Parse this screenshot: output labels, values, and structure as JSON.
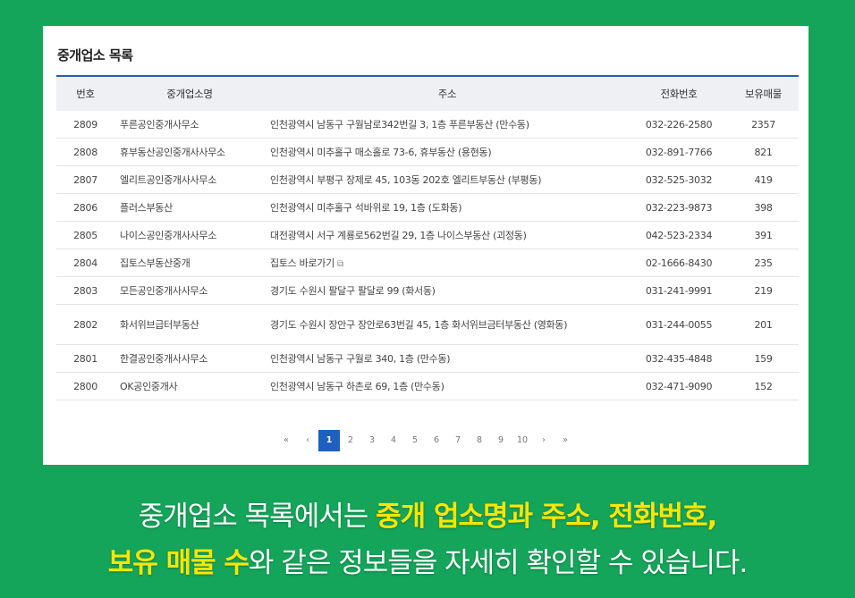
{
  "panel": {
    "title": "중개업소 목록",
    "columns": [
      "번호",
      "중개업소명",
      "주소",
      "전화번호",
      "보유매물"
    ],
    "rows": [
      {
        "no": "2809",
        "name": "푸른공인중개사무소",
        "address": "인천광역시 남동구 구월남로342번길 3, 1층 푸른부동산 (만수동)",
        "phone": "032-226-2580",
        "count": "2357"
      },
      {
        "no": "2808",
        "name": "휴부동산공인중개사사무소",
        "address": "인천광역시 미추홀구 매소홀로 73-6, 휴부동산 (용현동)",
        "phone": "032-891-7766",
        "count": "821"
      },
      {
        "no": "2807",
        "name": "엘리트공인중개사사무소",
        "address": "인천광역시 부평구 장제로 45, 103동 202호 엘리트부동산 (부평동)",
        "phone": "032-525-3032",
        "count": "419"
      },
      {
        "no": "2806",
        "name": "플러스부동산",
        "address": "인천광역시 미추홀구 석바위로 19, 1층 (도화동)",
        "phone": "032-223-9873",
        "count": "398"
      },
      {
        "no": "2805",
        "name": "나이스공인중개사사무소",
        "address": "대전광역시 서구 계룡로562번길 29, 1층 나이스부동산 (괴정동)",
        "phone": "042-523-2334",
        "count": "391"
      },
      {
        "no": "2804",
        "name": "집토스부동산중개",
        "address": "집토스 바로가기",
        "phone": "02-1666-8430",
        "count": "235",
        "link": true
      },
      {
        "no": "2803",
        "name": "모든공인중개사사무소",
        "address": "경기도 수원시 팔달구 팔달로 99 (화서동)",
        "phone": "031-241-9991",
        "count": "219"
      },
      {
        "no": "2802",
        "name": "화서위브급터부동산",
        "address": "경기도 수원시 장안구 장안로63번길 45, 1층 화서위브금터부동산 (영화동)",
        "phone": "031-244-0055",
        "count": "201",
        "tall": true
      },
      {
        "no": "2801",
        "name": "한결공인중개사사무소",
        "address": "인천광역시 남동구 구월로 340, 1층 (만수동)",
        "phone": "032-435-4848",
        "count": "159"
      },
      {
        "no": "2800",
        "name": "OK공인중개사",
        "address": "인천광역시 남동구 하촌로 69, 1층 (만수동)",
        "phone": "032-471-9090",
        "count": "152"
      }
    ]
  },
  "pagination": {
    "first": "«",
    "prev": "‹",
    "pages": [
      "1",
      "2",
      "3",
      "4",
      "5",
      "6",
      "7",
      "8",
      "9",
      "10"
    ],
    "current": "1",
    "next": "›",
    "last": "»"
  },
  "caption": {
    "line1_a": "중개업소 목록에서는 ",
    "line1_hl": "중개 업소명과 주소, 전화번호,",
    "line2_hl": "보유 매물 수",
    "line2_b": "와 같은 정보들을 자세히 확인할 수 있습니다."
  },
  "colors": {
    "background": "#14a45a",
    "highlight": "#ffe600",
    "header_border": "#2d5da8",
    "active_page": "#1f5fbf"
  }
}
